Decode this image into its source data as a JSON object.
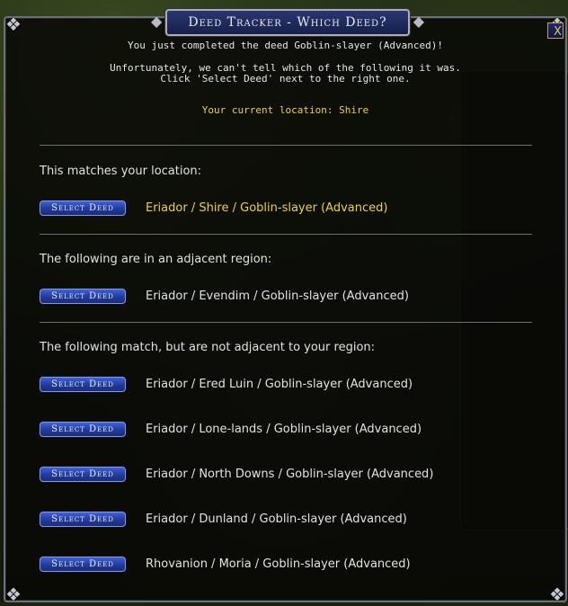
{
  "dialog": {
    "title": "Deed Tracker - Which Deed?",
    "close_label": "X",
    "intro_line1": "You just completed the deed Goblin-slayer (Advanced)!",
    "intro_line2": "Unfortunately, we can't tell which of the following it was.",
    "intro_line3": "Click 'Select Deed' next to the right one.",
    "location_text": "Your current location: Shire"
  },
  "sections": {
    "match": {
      "label": "This matches your location:",
      "items": [
        {
          "button": "Select Deed",
          "deed": "Eriador / Shire / Goblin-slayer (Advanced)"
        }
      ]
    },
    "adjacent": {
      "label": "The following are in an adjacent region:",
      "items": [
        {
          "button": "Select Deed",
          "deed": "Eriador / Evendim / Goblin-slayer (Advanced)"
        }
      ]
    },
    "other": {
      "label": "The following match, but are not adjacent to your region:",
      "items": [
        {
          "button": "Select Deed",
          "deed": "Eriador / Ered Luin / Goblin-slayer (Advanced)"
        },
        {
          "button": "Select Deed",
          "deed": "Eriador / Lone-lands / Goblin-slayer (Advanced)"
        },
        {
          "button": "Select Deed",
          "deed": "Eriador / North Downs / Goblin-slayer (Advanced)"
        },
        {
          "button": "Select Deed",
          "deed": "Eriador / Dunland / Goblin-slayer (Advanced)"
        },
        {
          "button": "Select Deed",
          "deed": "Rhovanion / Moria / Goblin-slayer (Advanced)"
        }
      ]
    }
  },
  "colors": {
    "highlight_text": "#e8d24a",
    "button_blue": "#223a9c",
    "frame": "#6d7078"
  },
  "icons": [
    "corner-ornament-icon",
    "close-icon"
  ]
}
